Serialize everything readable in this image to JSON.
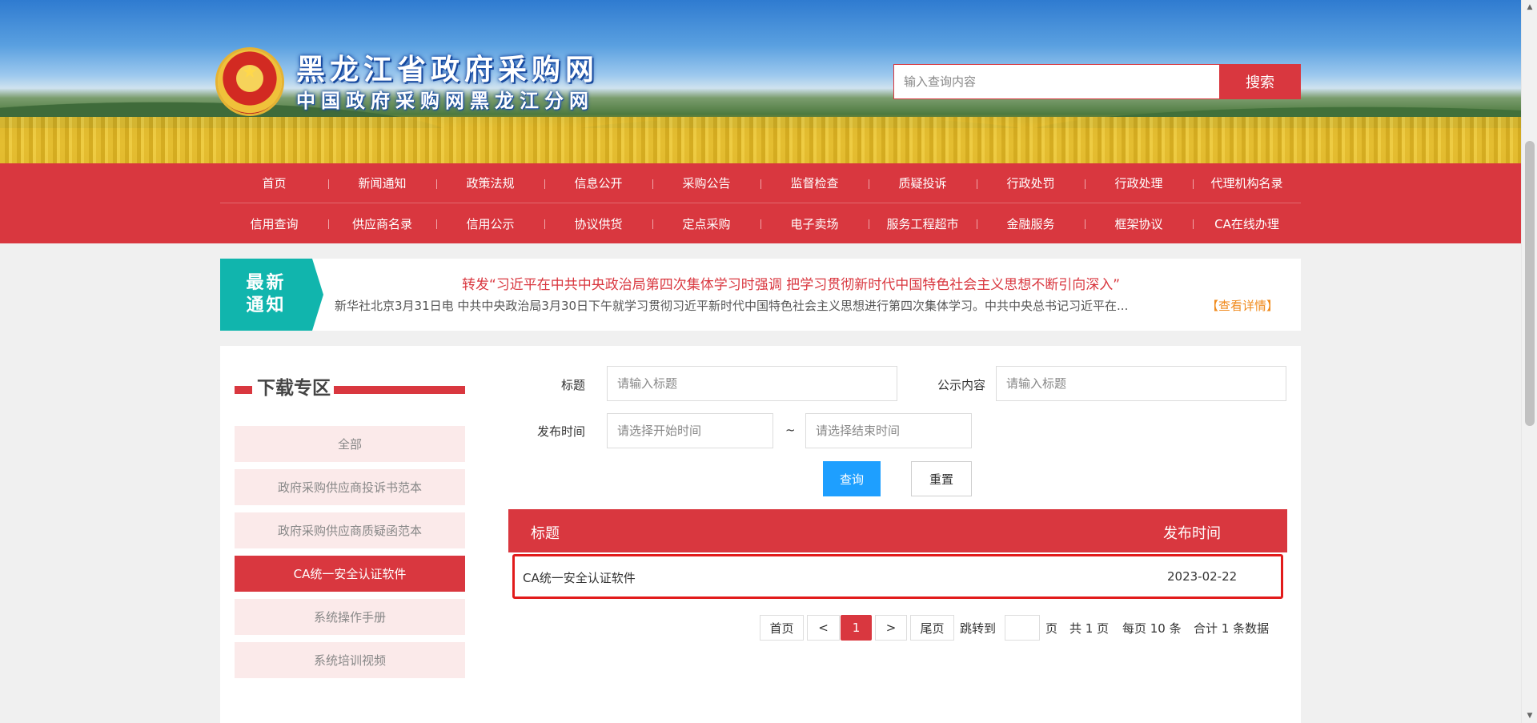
{
  "header": {
    "site_title": "黑龙江省政府采购网",
    "site_subtitle": "中国政府采购网黑龙江分网",
    "search_placeholder": "输入查询内容",
    "search_button": "搜索"
  },
  "nav": {
    "row1": [
      "首页",
      "新闻通知",
      "政策法规",
      "信息公开",
      "采购公告",
      "监督检查",
      "质疑投诉",
      "行政处罚",
      "行政处理",
      "代理机构名录"
    ],
    "row2": [
      "信用查询",
      "供应商名录",
      "信用公示",
      "协议供货",
      "定点采购",
      "电子卖场",
      "服务工程超市",
      "金融服务",
      "框架协议",
      "CA在线办理"
    ]
  },
  "notice": {
    "badge_line1": "最新",
    "badge_line2": "通知",
    "title": "转发“习近平在中共中央政治局第四次集体学习时强调 把学习贯彻新时代中国特色社会主义思想不断引向深入”",
    "summary": "新华社北京3月31日电 中共中央政治局3月30日下午就学习贯彻习近平新时代中国特色社会主义思想进行第四次集体学习。中共中央总书记习近平在...",
    "more_link": "【查看详情】"
  },
  "sidebar": {
    "title": "下载专区",
    "items": [
      {
        "label": "全部",
        "active": false
      },
      {
        "label": "政府采购供应商投诉书范本",
        "active": false
      },
      {
        "label": "政府采购供应商质疑函范本",
        "active": false
      },
      {
        "label": "CA统一安全认证软件",
        "active": true
      },
      {
        "label": "系统操作手册",
        "active": false
      },
      {
        "label": "系统培训视频",
        "active": false
      }
    ]
  },
  "filters": {
    "title_label": "标题",
    "title_placeholder": "请输入标题",
    "content_label": "公示内容",
    "content_placeholder": "请输入标题",
    "date_label": "发布时间",
    "start_placeholder": "请选择开始时间",
    "separator": "~",
    "end_placeholder": "请选择结束时间",
    "query_button": "查询",
    "reset_button": "重置"
  },
  "table": {
    "columns": [
      "标题",
      "发布时间"
    ],
    "rows": [
      {
        "title": "CA统一安全认证软件",
        "date": "2023-02-22"
      }
    ]
  },
  "pagination": {
    "first": "首页",
    "prev": "<",
    "current": "1",
    "next": ">",
    "last": "尾页",
    "jump_label": "跳转到",
    "page_unit": "页",
    "total_pages": "共 1 页",
    "per_page": "每页 10 条",
    "total_records": "合计 1 条数据"
  },
  "colors": {
    "brand_red": "#d9373f",
    "teal": "#11b5ad",
    "query_blue": "#1e9fff",
    "notice_orange": "#f08a1c"
  }
}
